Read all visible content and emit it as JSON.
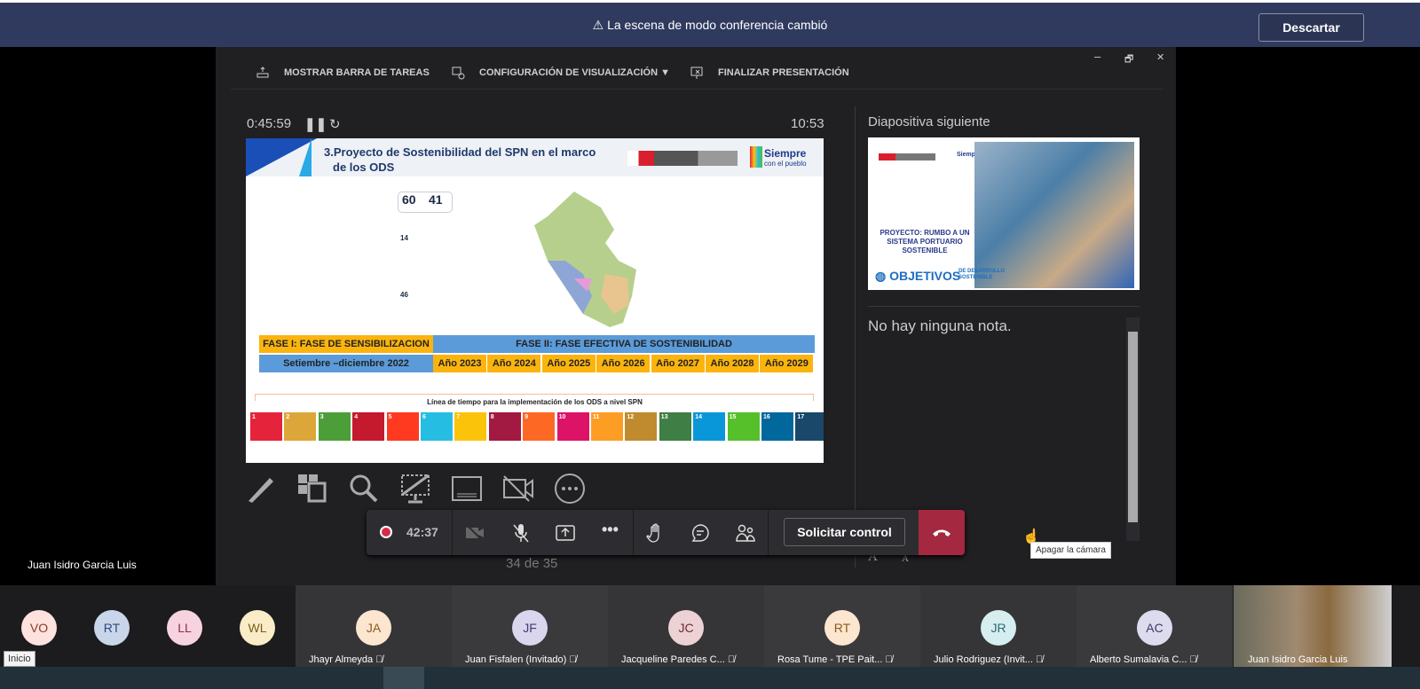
{
  "banner": {
    "message": "La escena de modo conferencia cambió",
    "dismiss": "Descartar"
  },
  "toolbar": {
    "show_taskbar": "MOSTRAR BARRA DE TAREAS",
    "display_settings": "CONFIGURACIÓN DE VISUALIZACIÓN ▼",
    "end_show": "FINALIZAR PRESENTACIÓN"
  },
  "window_controls": {
    "minimize": "–",
    "restore": "🗗",
    "close": "✕"
  },
  "timer": {
    "elapsed": "0:45:59",
    "clock": "10:53"
  },
  "slide": {
    "title_line1": "3.Proyecto de Sostenibilidad del SPN en el marco",
    "title_line2": "de los ODS",
    "brand": "Siempre",
    "brand_sub": "con el pueblo",
    "stat1": "60",
    "stat2": "41",
    "stat3": "14",
    "stat4": "46",
    "phase1": "FASE I: FASE DE SENSIBILIZACION",
    "phase2": "FASE II: FASE EFECTIVA DE SOSTENIBILIDAD",
    "phase1_period": "Setiembre –diciembre 2022",
    "years": [
      "Año 2023",
      "Año 2024",
      "Año 2025",
      "Año 2026",
      "Año 2027",
      "Año 2028",
      "Año 2029"
    ],
    "timeline_caption": "Línea de tiempo para la implementación de los ODS a nivel SPN",
    "sdg_colors": [
      "#e5243b",
      "#dda63a",
      "#4c9f38",
      "#c5192d",
      "#ff3a21",
      "#26bde2",
      "#fcc30b",
      "#a21942",
      "#fd6925",
      "#dd1367",
      "#fd9d24",
      "#bf8b2e",
      "#3f7e44",
      "#0a97d9",
      "#56c02b",
      "#00689d",
      "#19486a"
    ]
  },
  "next_slide": {
    "label": "Diapositiva siguiente",
    "title": "PROYECTO: RUMBO A UN SISTEMA PORTUARIO SOSTENIBLE",
    "ods": "OBJETIVOS",
    "ods_sub1": "DE DESARROLLO",
    "ods_sub2": "SOSTENIBLE"
  },
  "notes": {
    "text": "No hay ninguna nota."
  },
  "meeting": {
    "recording_time": "42:37",
    "request_control": "Solicitar control",
    "slide_counter": "34 de 35"
  },
  "tooltip": "Apagar la cámara",
  "speaker_name": "Juan Isidro Garcia Luis",
  "participants_small": [
    {
      "initials": "VO",
      "bg": "#fde2dd",
      "fg": "#8a3b2c"
    },
    {
      "initials": "RT",
      "bg": "#c9d6ea",
      "fg": "#2d4a7a"
    },
    {
      "initials": "LL",
      "bg": "#f6d3de",
      "fg": "#8a2d4f"
    },
    {
      "initials": "WL",
      "bg": "#f9ecc7",
      "fg": "#7a5d1a"
    }
  ],
  "participants": [
    {
      "initials": "JA",
      "name": "Jhayr Almeyda",
      "bg": "#fde6cf",
      "fg": "#8a5a1a"
    },
    {
      "initials": "JF",
      "name": "Juan Fisfalen (Invitado)",
      "bg": "#d9d6ee",
      "fg": "#3e3a7a"
    },
    {
      "initials": "JC",
      "name": "Jacqueline Paredes C...",
      "bg": "#ecd2d4",
      "fg": "#6e2a30"
    },
    {
      "initials": "RT",
      "name": "Rosa Tume - TPE Pait...",
      "bg": "#fde6cf",
      "fg": "#8a5a1a"
    },
    {
      "initials": "JR",
      "name": "Julio Rodriguez (Invit...",
      "bg": "#d6eef0",
      "fg": "#2a6a72"
    },
    {
      "initials": "AC",
      "name": "Alberto Sumalavia C...",
      "bg": "#dddcee",
      "fg": "#3e3a6a"
    }
  ],
  "video_name": "Juan Isidro Garcia Luis",
  "start_tooltip": "Inicio"
}
